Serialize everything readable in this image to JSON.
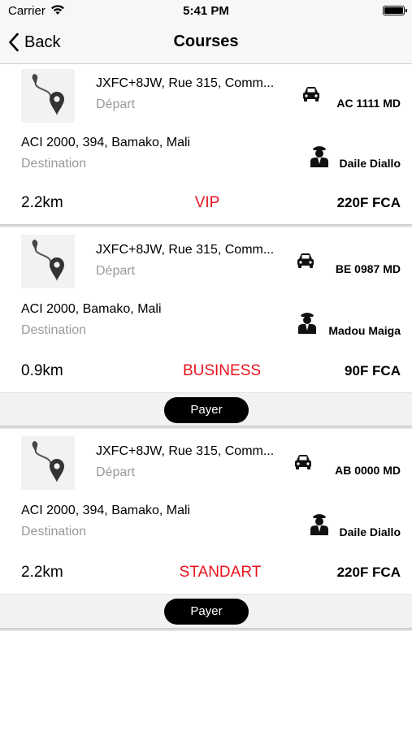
{
  "status_bar": {
    "carrier": "Carrier",
    "time": "5:41 PM",
    "icons": [
      "wifi-icon",
      "battery-icon"
    ]
  },
  "nav": {
    "back_label": "Back",
    "title": "Courses"
  },
  "courses": [
    {
      "departure_address": "JXFC+8JW, Rue 315, Comm...",
      "departure_label": "Départ",
      "destination_address": "ACI 2000, 394, Bamako, Mali",
      "destination_label": "Destination",
      "plate": "AC 1111 MD",
      "driver": "Daile Diallo",
      "distance": "2.2km",
      "type": "VIP",
      "price": "220F FCA"
    },
    {
      "departure_address": "JXFC+8JW, Rue 315, Comm...",
      "departure_label": "Départ",
      "destination_address": "ACI 2000, Bamako, Mali",
      "destination_label": "Destination",
      "plate": "BE 0987 MD",
      "driver": "Madou Maiga",
      "distance": "0.9km",
      "type": "BUSINESS",
      "price": "90F FCA",
      "pay_label": "Payer"
    },
    {
      "departure_address": "JXFC+8JW, Rue 315, Comm...",
      "departure_label": "Départ",
      "destination_address": "ACI 2000, 394, Bamako, Mali",
      "destination_label": "Destination",
      "plate": "AB 0000 MD",
      "driver": "Daile Diallo",
      "distance": "2.2km",
      "type": "STANDART",
      "price": "220F FCA",
      "pay_label": "Payer"
    }
  ],
  "colors": {
    "course_type": "#e8141e",
    "secondary_text": "#9a9a9a",
    "bar_background": "#f7f7f7",
    "pay_button": "#000000"
  }
}
